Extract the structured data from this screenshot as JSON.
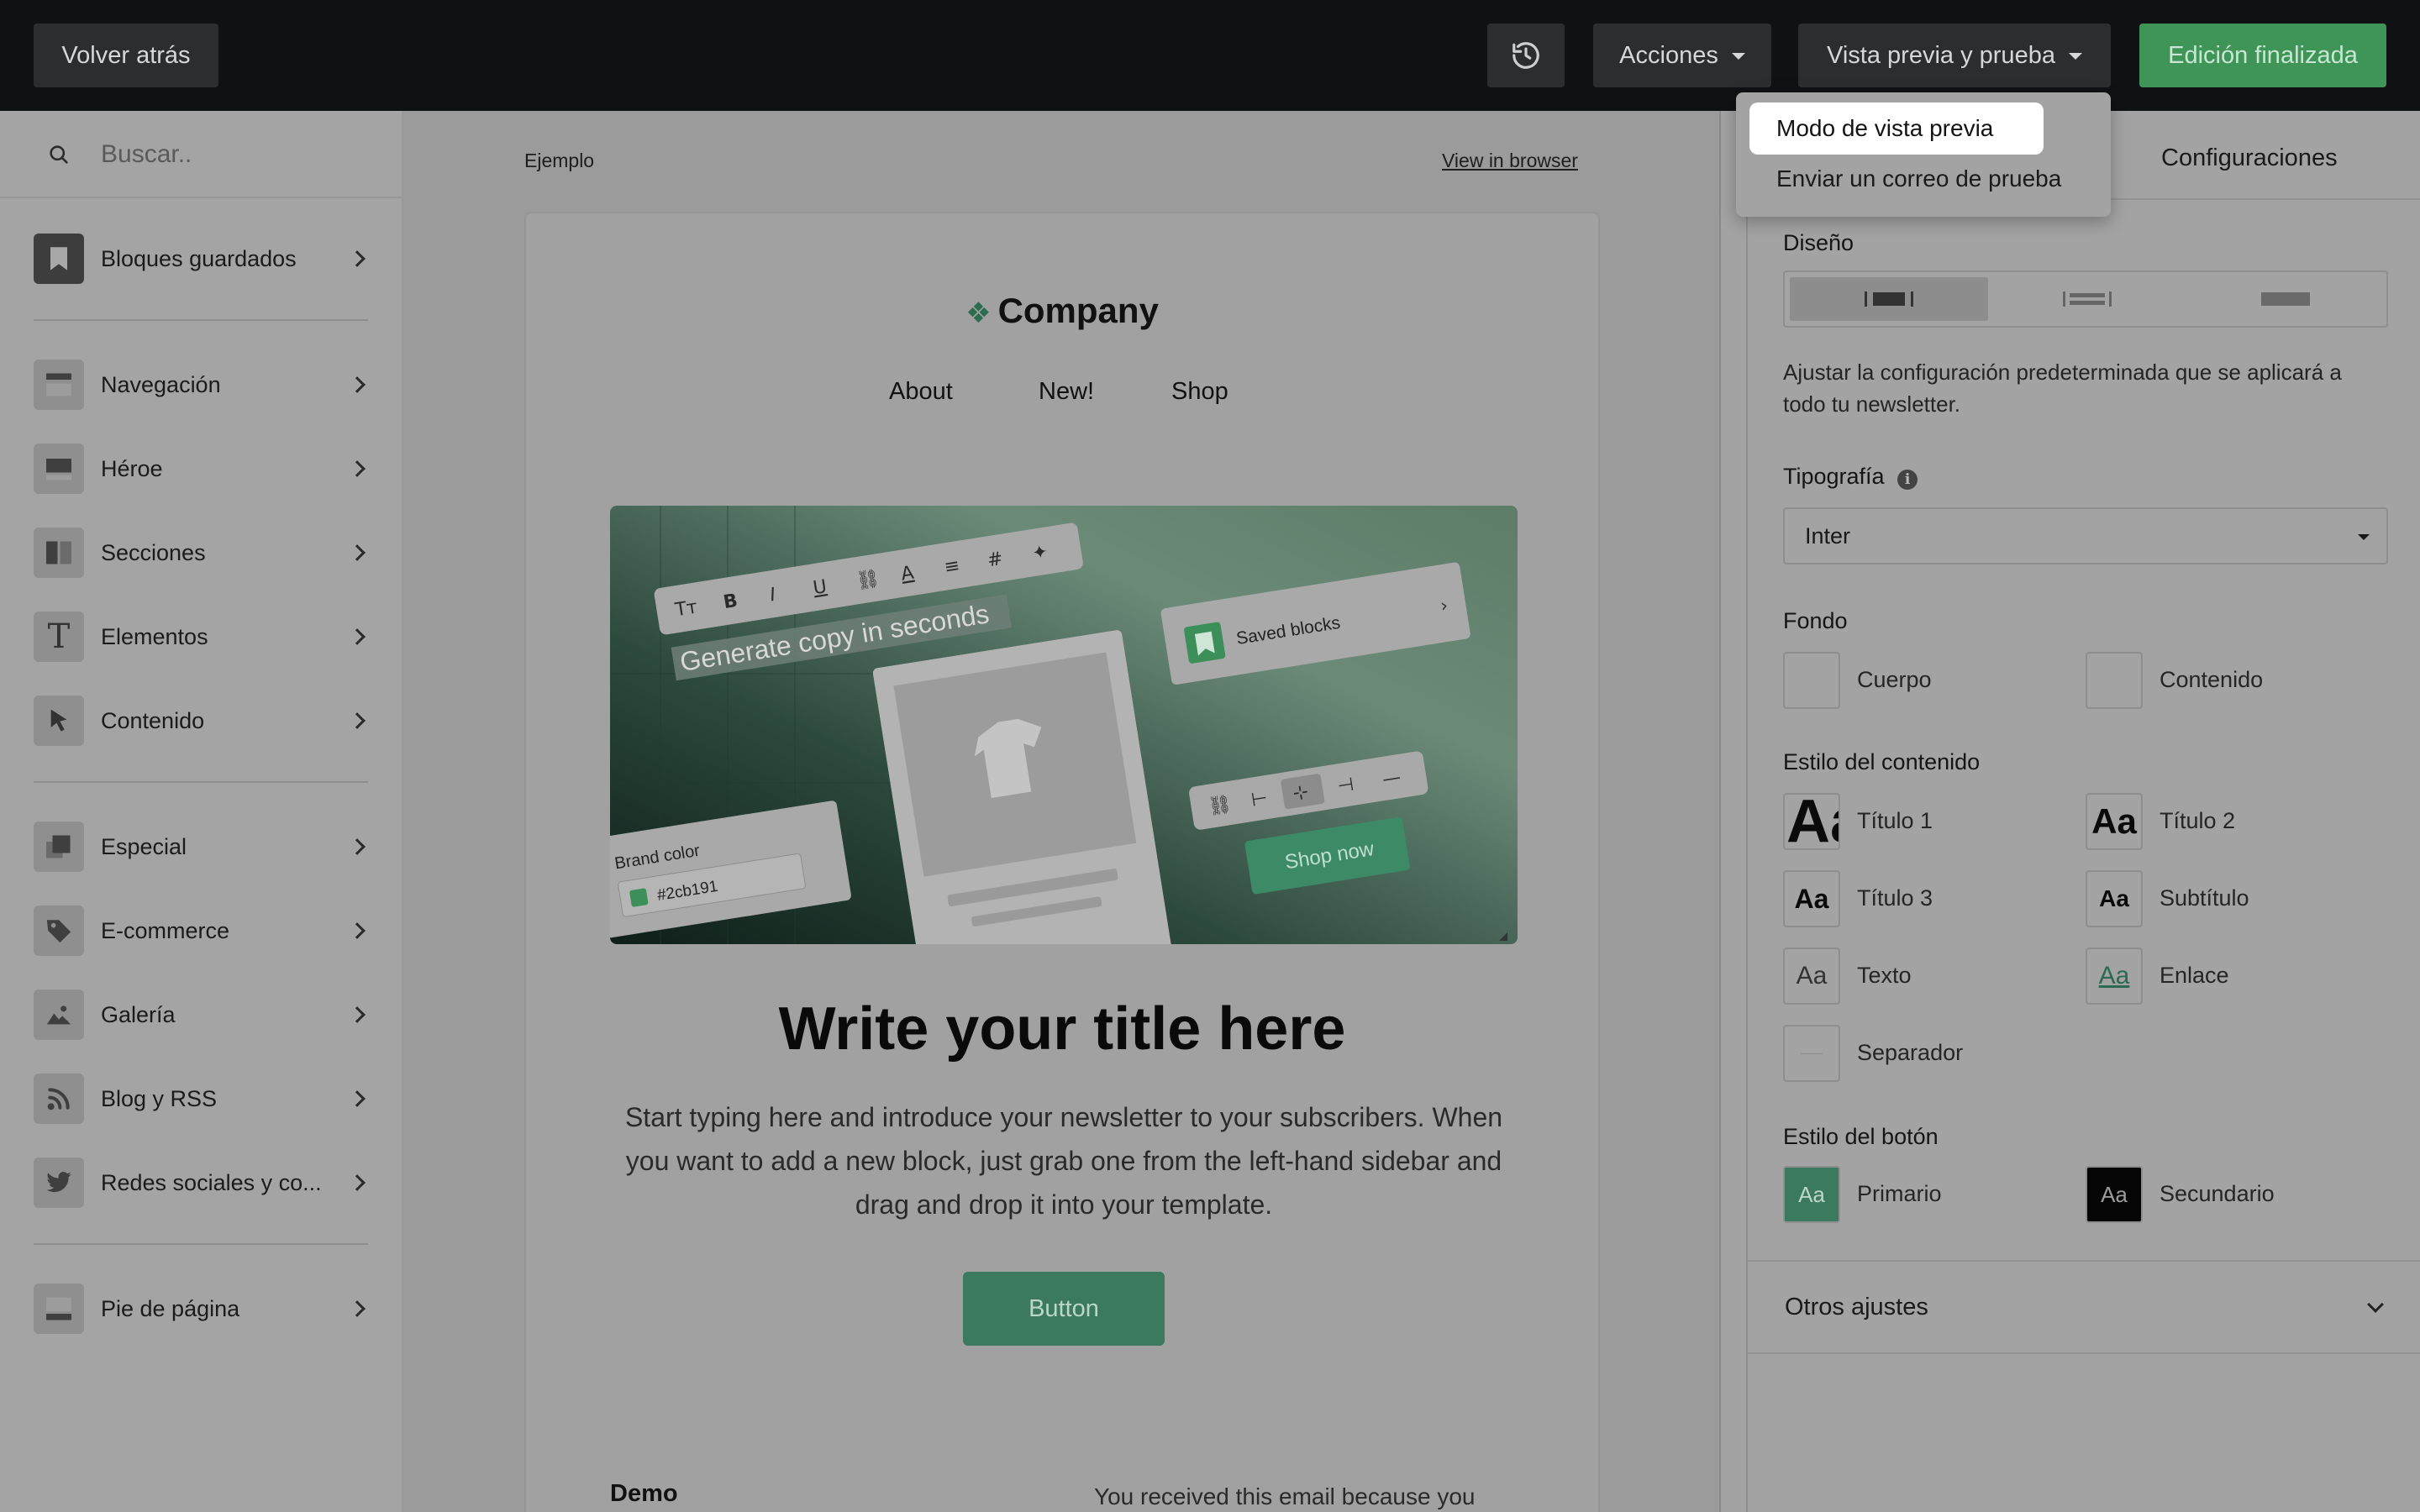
{
  "topbar": {
    "back_label": "Volver atrás",
    "history_icon": "history-icon",
    "actions_label": "Acciones",
    "preview_label": "Vista previa y prueba",
    "done_label": "Edición finalizada"
  },
  "preview_menu": {
    "items": [
      {
        "label": "Modo de vista previa"
      },
      {
        "label": "Enviar un correo de prueba"
      }
    ]
  },
  "sidebar": {
    "search_placeholder": "Buscar..",
    "items": [
      {
        "label": "Bloques guardados",
        "icon": "bookmark-icon"
      },
      {
        "label": "Navegación",
        "icon": "navigation-icon"
      },
      {
        "label": "Héroe",
        "icon": "hero-icon"
      },
      {
        "label": "Secciones",
        "icon": "columns-icon"
      },
      {
        "label": "Elementos",
        "icon": "text-icon"
      },
      {
        "label": "Contenido",
        "icon": "cursor-icon"
      },
      {
        "label": "Especial",
        "icon": "layers-icon"
      },
      {
        "label": "E-commerce",
        "icon": "tag-icon"
      },
      {
        "label": "Galería",
        "icon": "image-icon"
      },
      {
        "label": "Blog y RSS",
        "icon": "rss-icon"
      },
      {
        "label": "Redes sociales y co...",
        "icon": "twitter-icon"
      },
      {
        "label": "Pie de página",
        "icon": "footer-icon"
      }
    ]
  },
  "canvas": {
    "preheader": "Ejemplo",
    "view_in_browser": "View in browser",
    "email": {
      "brand": "Company",
      "nav": [
        "About",
        "New!",
        "Shop"
      ],
      "hero": {
        "headline": "Generate copy in seconds",
        "saved_blocks": "Saved blocks",
        "brand_color_label": "Brand color",
        "brand_color_value": "#2cb191",
        "shop_now": "Shop now"
      },
      "title": "Write your title here",
      "body": "Start typing here and introduce your newsletter to your subscribers. When you want to add a new block, just grab one from the left-hand sidebar and drag and drop it into your template.",
      "button": "Button",
      "footer_title": "Demo",
      "footer_note": "You received this email because you"
    }
  },
  "right_panel": {
    "tab": "Configuraciones",
    "design_title": "Diseño",
    "design_desc": "Ajustar la configuración predeterminada que se aplicará a todo tu newsletter.",
    "typography_title": "Tipografía",
    "font_value": "Inter",
    "background_title": "Fondo",
    "background": [
      {
        "label": "Cuerpo"
      },
      {
        "label": "Contenido"
      }
    ],
    "content_style_title": "Estilo del contenido",
    "content_styles": [
      {
        "label": "Título 1",
        "sample": "Aa"
      },
      {
        "label": "Título 2",
        "sample": "Aa"
      },
      {
        "label": "Título 3",
        "sample": "Aa"
      },
      {
        "label": "Subtítulo",
        "sample": "Aa"
      },
      {
        "label": "Texto",
        "sample": "Aa"
      },
      {
        "label": "Enlace",
        "sample": "Aa"
      },
      {
        "label": "Separador",
        "sample": ""
      }
    ],
    "button_style_title": "Estilo del botón",
    "button_styles": [
      {
        "label": "Primario",
        "sample": "Aa"
      },
      {
        "label": "Secundario",
        "sample": "Aa"
      }
    ],
    "other_settings": "Otros ajustes"
  },
  "colors": {
    "topbar_bg": "#101114",
    "accent_green": "#3f9558",
    "brand_green": "#2cb191"
  }
}
